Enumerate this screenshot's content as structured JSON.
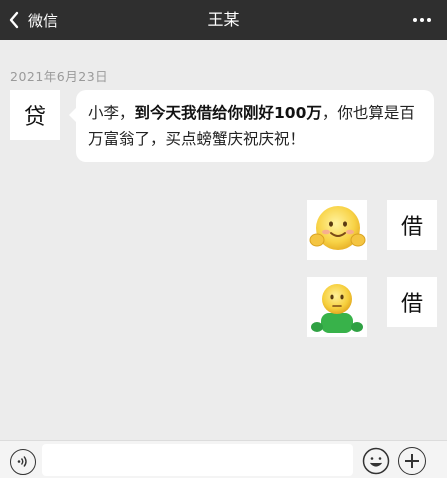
{
  "header": {
    "back_label": "微信",
    "title": "王某",
    "back_icon": "chevron-left-icon",
    "more_icon": "more-dots-icon"
  },
  "chat": {
    "date": "2021年6月23日",
    "incoming": {
      "avatar_text": "贷",
      "parts": [
        {
          "text": "小李，",
          "bold": false
        },
        {
          "text": "到今天我借给你刚好100万",
          "bold": true
        },
        {
          "text": "，你也算是百万富翁了，买点螃蟹庆祝庆祝！",
          "bold": false
        }
      ]
    },
    "outgoing": [
      {
        "avatar_text": "借",
        "sticker": "smiling-emoji-thumbs-sticker"
      },
      {
        "avatar_text": "借",
        "sticker": "green-shirt-emoji-sticker"
      }
    ]
  },
  "input_bar": {
    "voice_icon": "voice-icon",
    "emoji_icon": "emoji-icon",
    "plus_icon": "plus-icon",
    "input_value": ""
  }
}
